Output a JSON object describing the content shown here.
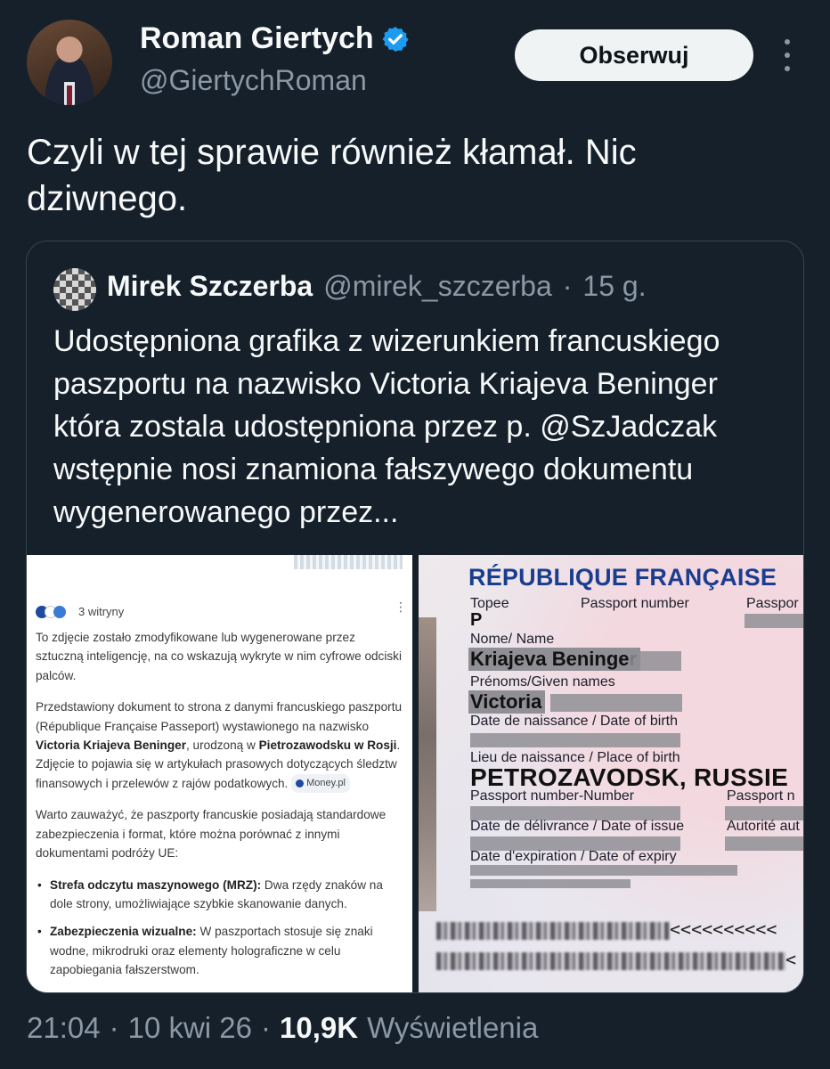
{
  "author": {
    "name": "Roman Giertych",
    "handle": "@GiertychRoman",
    "verified_color": "#1d9bf0"
  },
  "follow_label": "Obserwuj",
  "tweet_text": "Czyli w tej sprawie również kłamał. Nic dziwnego.",
  "quote": {
    "name": "Mirek Szczerba",
    "handle": "@mirek_szczerba",
    "separator": "·",
    "time": "15 g.",
    "text": "Udostępniona grafika z wizerunkiem francuskiego paszportu na nazwisko Victoria Kriajeva Beninger która zostala udostępniona przez p. @SzJadczak  wstępnie nosi znamiona fałszywego dokumentu wygenerowanego przez..."
  },
  "ai_panel": {
    "sources": "3 witryny",
    "p1": "To zdjęcie zostało zmodyfikowane lub wygenerowane przez sztuczną inteligencję, na co wskazują wykryte w nim cyfrowe odciski palców.",
    "p2_a": "Przedstawiony dokument to strona z danymi francuskiego paszportu (République Française Passeport) wystawionego na nazwisko ",
    "p2_name": "Victoria Kriajeva Beninger",
    "p2_b": ", urodzoną w ",
    "p2_place": "Pietrozawodsku w Rosji",
    "p2_c": ". Zdjęcie to pojawia się w artykułach prasowych dotyczących śledztw finansowych i przelewów z rajów podatkowych.",
    "cite": "Money.pl",
    "p3": "Warto zauważyć, że paszporty francuskie posiadają standardowe zabezpieczenia i format, które można porównać z innymi dokumentami podróży UE:",
    "b1_title": "Strefa odczytu maszynowego (MRZ):",
    "b1_text": " Dwa rzędy znaków na dole strony, umożliwiające szybkie skanowanie danych.",
    "b2_title": "Zabezpieczenia wizualne:",
    "b2_text": " W paszportach stosuje się znaki wodne, mikrodruki oraz elementy holograficzne w celu zapobiegania fałszerstwom."
  },
  "passport": {
    "title": "RÉPUBLIQUE FRANÇAISE",
    "type_label": "Topee",
    "type_value": "P",
    "passport_number_label": "Passport number",
    "passport_label_cut": "Passpor",
    "name_label": "Nome/ Name",
    "name_value": "Kriajeva Beninger",
    "given_label": "Prénoms/Given names",
    "given_value": "Victoria",
    "dob_label": "Date de naissance / Date of birth",
    "pob_label": "Lieu de naissance / Place of birth",
    "pob_value": "PETROZAVODSK, RUSSIE",
    "ppnum_label": "Passport number-Number",
    "ppnum_label_cut": "Passport n",
    "issue_label": "Date de délivrance / Date of issue",
    "authority_label": "Autorité aut",
    "expiry_label": "Date d'expiration / Date of expiry",
    "mrz1_chevrons": "<<<<<<<<<<",
    "mrz2_chevrons": "<"
  },
  "meta": {
    "time": "21:04",
    "sep1": "·",
    "date": "10 kwi 26",
    "sep2": "·",
    "views": "10,9K",
    "views_label": "Wyświetlenia"
  }
}
